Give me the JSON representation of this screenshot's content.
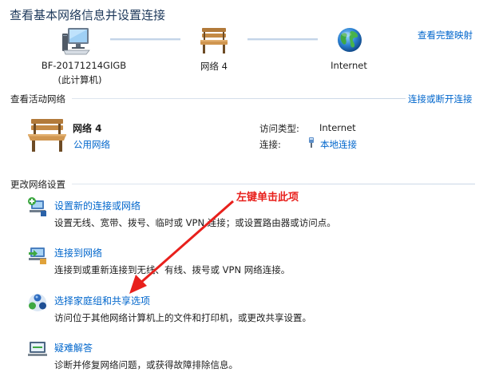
{
  "header": {
    "title": "查看基本网络信息并设置连接",
    "full_map_link": "查看完整映射"
  },
  "network_map": {
    "computer_name": "BF-20171214GIGB",
    "computer_sub": "(此计算机)",
    "network_name": "网络  4",
    "internet_label": "Internet"
  },
  "active_networks": {
    "section_title": "查看活动网络",
    "connect_link": "连接或断开连接",
    "network_name": "网络  4",
    "network_type": "公用网络",
    "access_type_label": "访问类型:",
    "access_type_value": "Internet",
    "connections_label": "连接:",
    "connections_value": "本地连接"
  },
  "change_settings": {
    "section_title": "更改网络设置",
    "tasks": [
      {
        "icon": "new-connection-icon",
        "link": "设置新的连接或网络",
        "desc": "设置无线、宽带、拨号、临时或 VPN 连接；或设置路由器或访问点。"
      },
      {
        "icon": "connect-network-icon",
        "link": "连接到网络",
        "desc": "连接到或重新连接到无线、有线、拨号或 VPN 网络连接。"
      },
      {
        "icon": "homegroup-icon",
        "link": "选择家庭组和共享选项",
        "desc": "访问位于其他网络计算机上的文件和打印机，或更改共享设置。"
      },
      {
        "icon": "troubleshoot-icon",
        "link": "疑难解答",
        "desc": "诊断并修复网络问题，或获得故障排除信息。"
      }
    ]
  },
  "annotation": {
    "text": "左键单击此项",
    "color": "#e8201c"
  },
  "colors": {
    "title": "#1e395b",
    "link": "#0066cc",
    "line": "#c3d4e8"
  }
}
